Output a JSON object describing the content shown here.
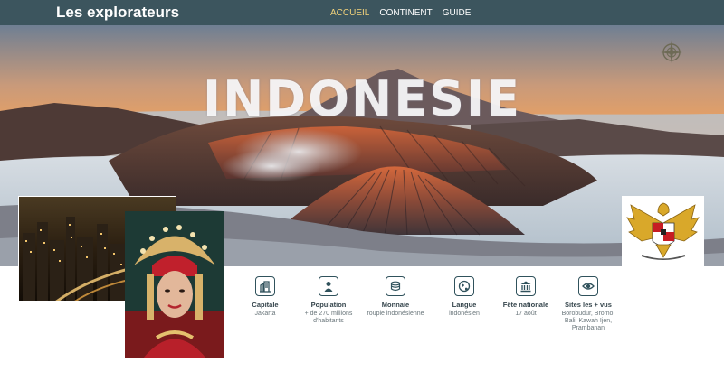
{
  "nav": {
    "brand": "Les explorateurs",
    "links": [
      "ACCUEIL",
      "CONTINENT",
      "GUIDE"
    ],
    "active_index": 0
  },
  "hero": {
    "title": "INDONESIE"
  },
  "facts": [
    {
      "icon": "city-icon",
      "label": "Capitale",
      "value": "Jakarta"
    },
    {
      "icon": "person-icon",
      "label": "Population",
      "value": "+ de 270 millions d'habitants"
    },
    {
      "icon": "coins-icon",
      "label": "Monnaie",
      "value": "roupie indonésienne"
    },
    {
      "icon": "globe-icon",
      "label": "Langue",
      "value": "indonésien"
    },
    {
      "icon": "monument-icon",
      "label": "Fête nationale",
      "value": "17 août"
    },
    {
      "icon": "eye-icon",
      "label": "Sites les + vus",
      "value": "Borobudur, Bromo, Bali, Kawah Ijen, Prambanan"
    }
  ],
  "colors": {
    "nav_bg": "#3c555e",
    "nav_active": "#f3d37b",
    "icon_border": "#30525c"
  }
}
